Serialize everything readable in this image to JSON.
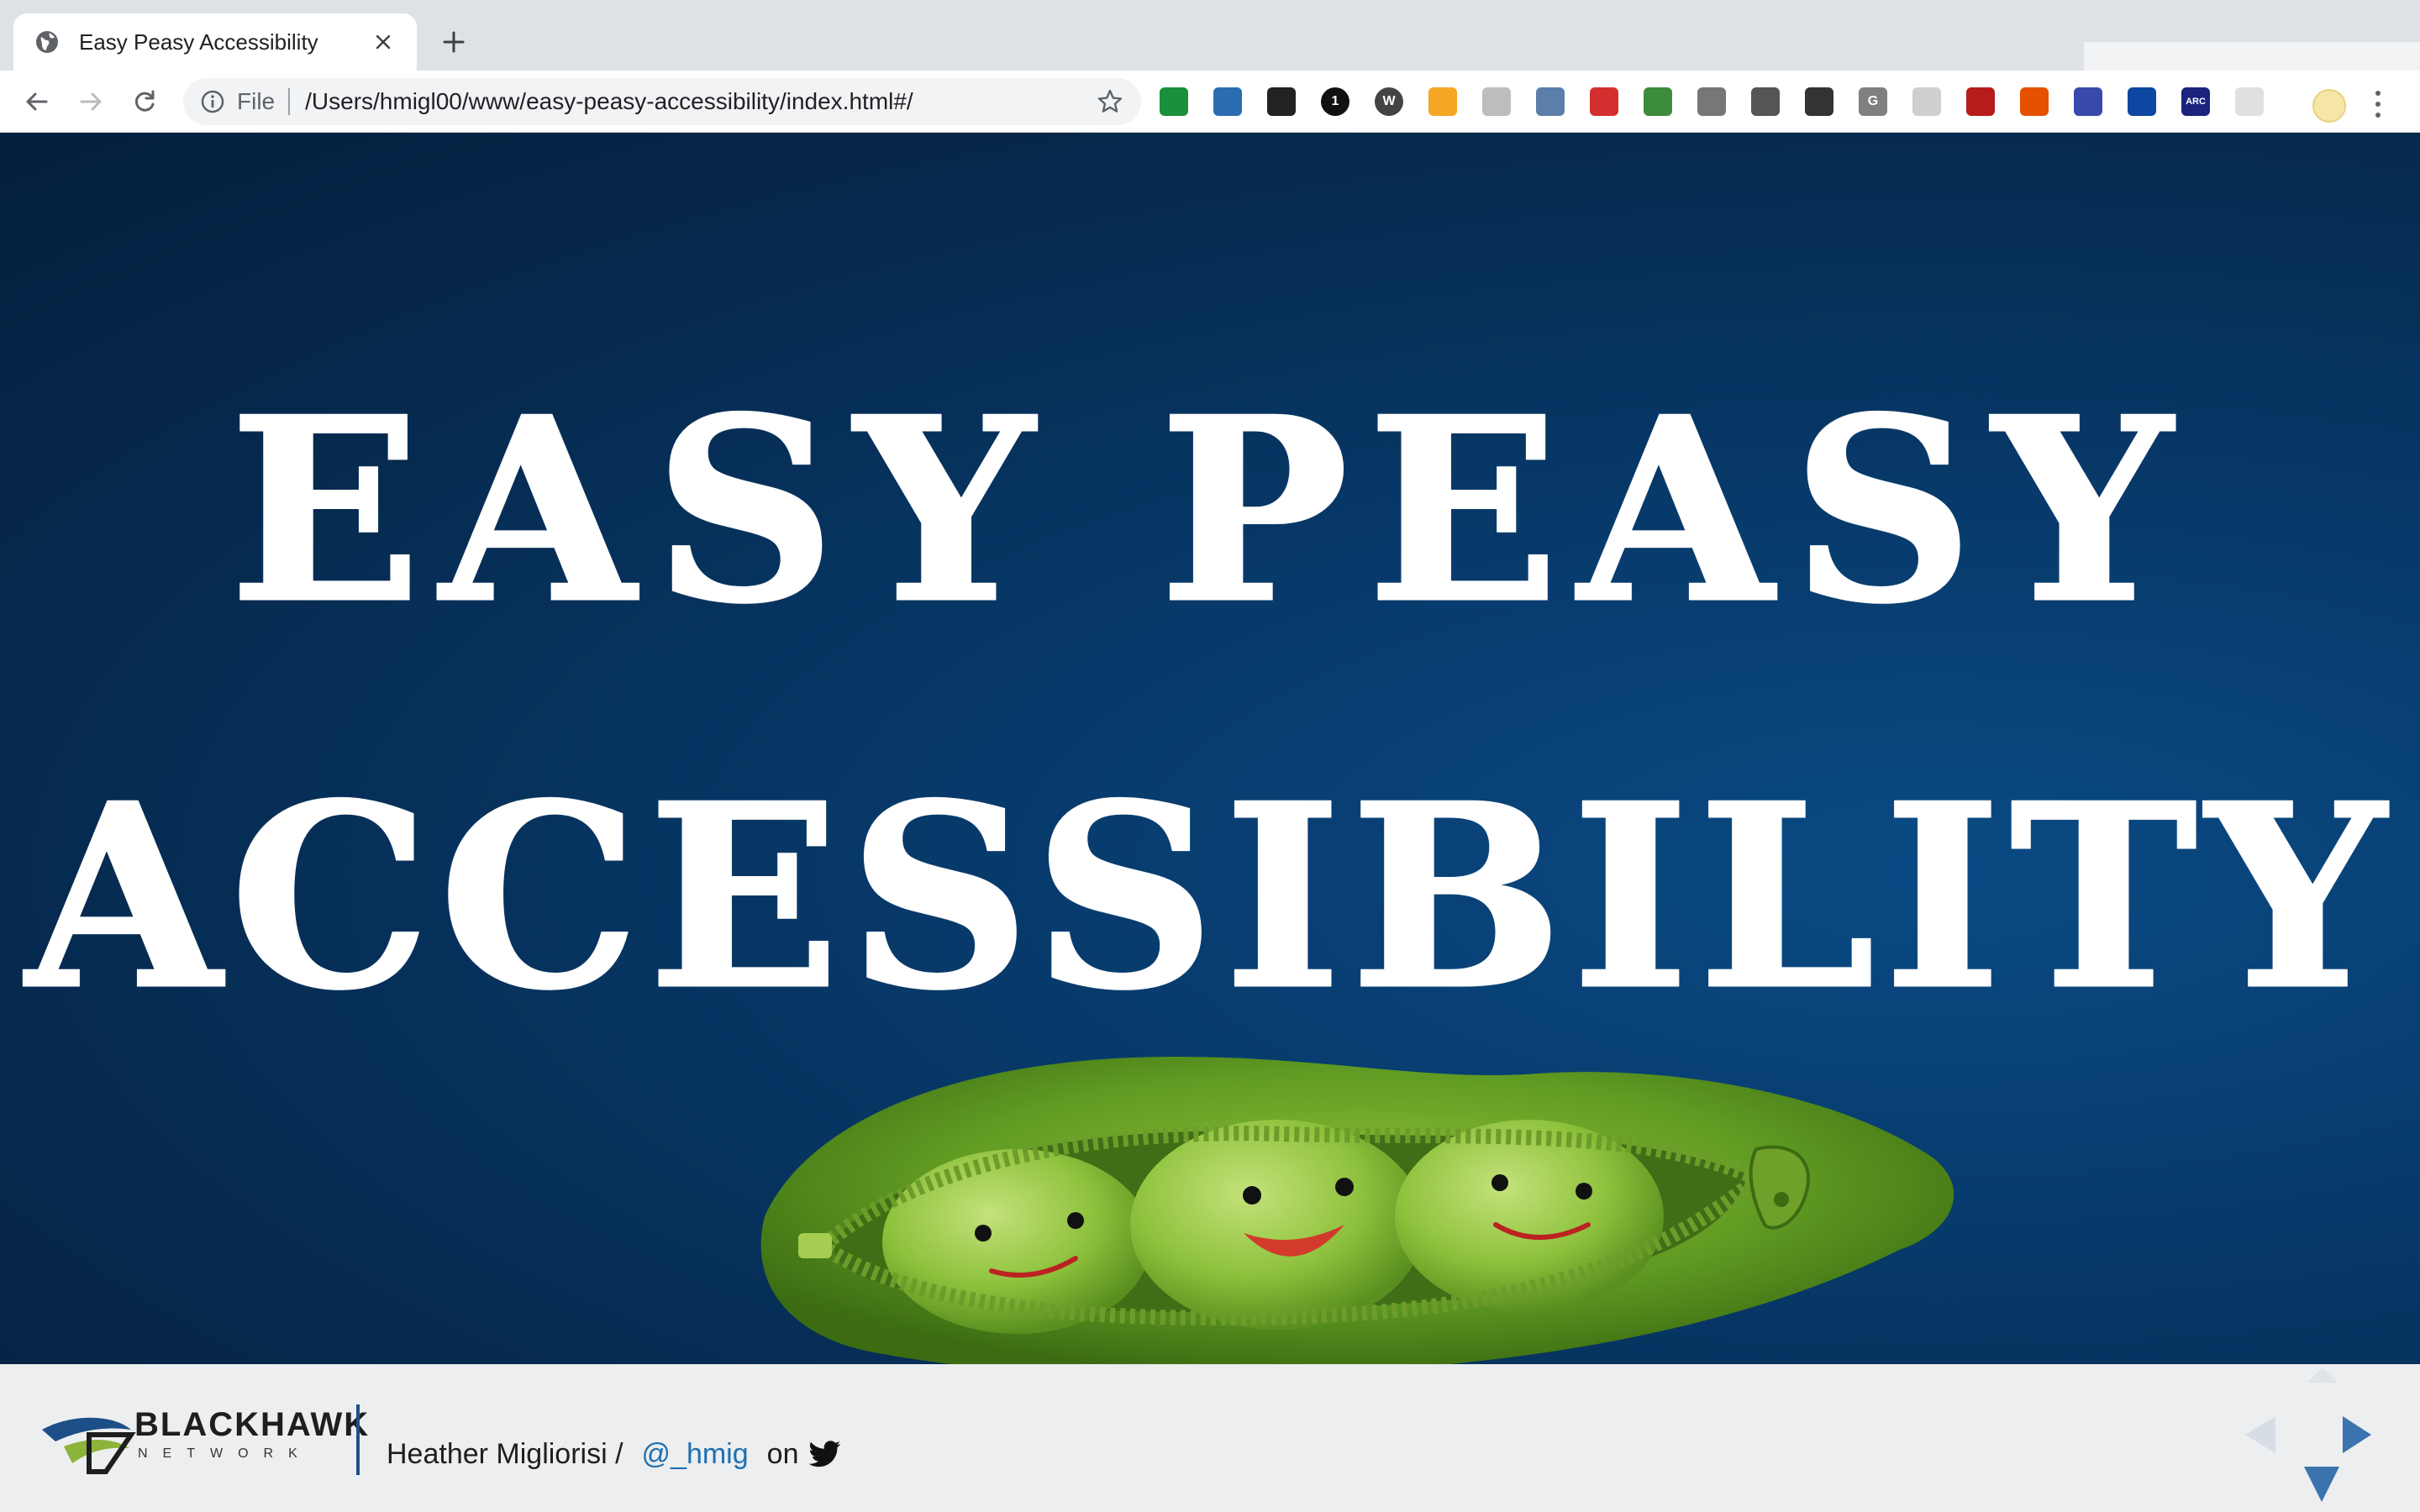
{
  "browser": {
    "tab": {
      "title": "Easy Peasy Accessibility",
      "favicon": "globe-icon"
    },
    "address": {
      "scheme": "File",
      "url": "/Users/hmigl00/www/easy-peasy-accessibility/index.html#/"
    },
    "extensions": [
      {
        "name": "colorzilla-icon",
        "color": "#1b8f3a",
        "label": ""
      },
      {
        "name": "wave-icon",
        "color": "#2a6db0",
        "label": ""
      },
      {
        "name": "screenshot-icon",
        "color": "#222222",
        "label": ""
      },
      {
        "name": "onepassword-icon",
        "color": "#111111",
        "label": "1"
      },
      {
        "name": "wappalyzer-icon",
        "color": "#444444",
        "label": "W"
      },
      {
        "name": "sun-icon",
        "color": "#f5a623",
        "label": ""
      },
      {
        "name": "code-icon",
        "color": "#bdbdbd",
        "label": ""
      },
      {
        "name": "eyedropper-icon",
        "color": "#5b7fa8",
        "label": ""
      },
      {
        "name": "angular-icon",
        "color": "#d32f2f",
        "label": ""
      },
      {
        "name": "alt-text-icon",
        "color": "#3d8b3d",
        "label": ""
      },
      {
        "name": "game-icon",
        "color": "#777777",
        "label": ""
      },
      {
        "name": "circle-icon",
        "color": "#555555",
        "label": ""
      },
      {
        "name": "hand-icon",
        "color": "#333333",
        "label": ""
      },
      {
        "name": "grammarly-icon",
        "color": "#808080",
        "label": "G"
      },
      {
        "name": "document-icon",
        "color": "#cfcfcf",
        "label": ""
      },
      {
        "name": "ublock-icon",
        "color": "#b71c1c",
        "label": ""
      },
      {
        "name": "color-wheel-icon",
        "color": "#e65100",
        "label": ""
      },
      {
        "name": "flag-icon",
        "color": "#3949ab",
        "label": ""
      },
      {
        "name": "magnifier-heart-icon",
        "color": "#0d47a1",
        "label": ""
      },
      {
        "name": "arc-icon",
        "color": "#1a237e",
        "label": "ARC"
      },
      {
        "name": "puzzle-icon",
        "color": "#e0e0e0",
        "label": ""
      }
    ]
  },
  "slide": {
    "title_line1": "EASY PEASY",
    "title_line2": "ACCESSIBILITY",
    "illustration": "pea-pod-illustration"
  },
  "footer": {
    "brand": {
      "name": "BLACKHAWK",
      "sub": "NETWORK"
    },
    "author": "Heather Migliorisi /",
    "handle": "@_hmig",
    "on_text": "on",
    "social_icon": "twitter-icon"
  }
}
